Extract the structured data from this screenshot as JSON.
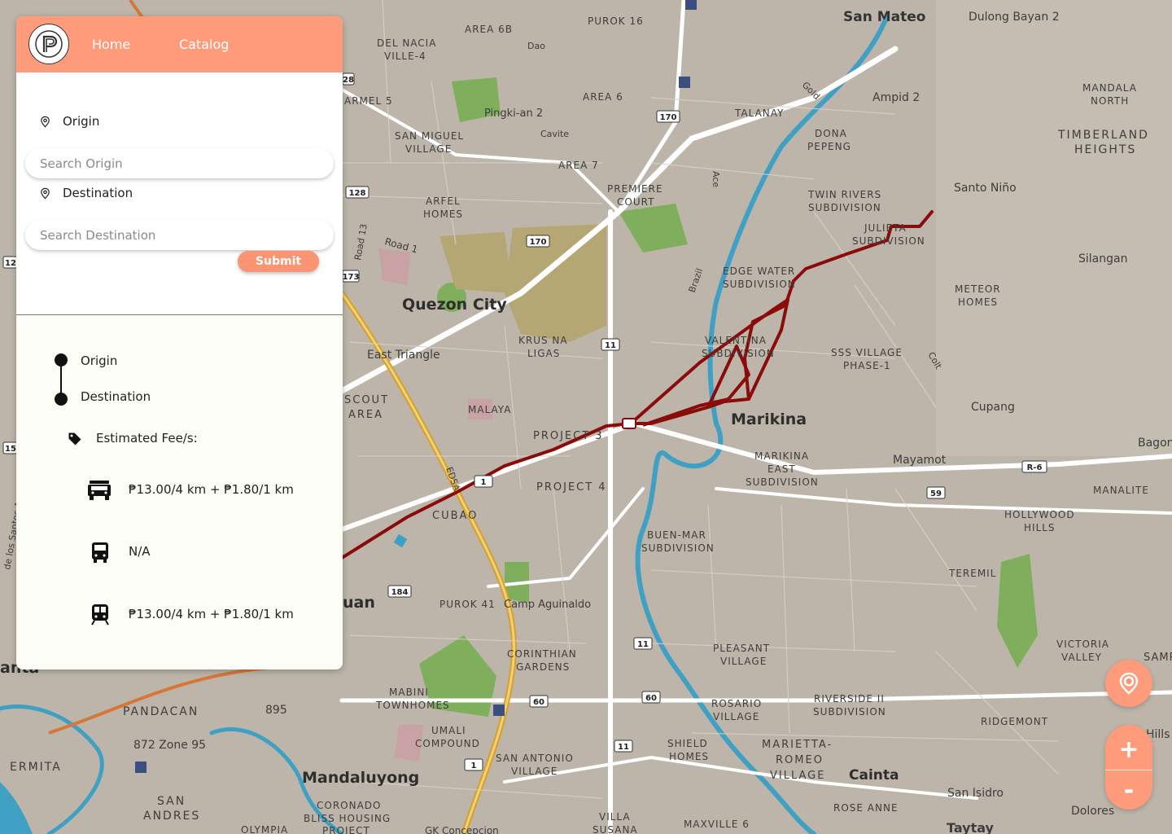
{
  "header": {
    "nav_home": "Home",
    "nav_catalog": "Catalog",
    "logo_icon": "p-logo-icon"
  },
  "search": {
    "origin_label": "Origin",
    "origin_placeholder": "Search Origin",
    "origin_value": "",
    "destination_label": "Destination",
    "destination_placeholder": "Search Destination",
    "destination_value": "",
    "submit_label": "Submit"
  },
  "route": {
    "origin_label": "Origin",
    "destination_label": "Destination",
    "fee_heading": "Estimated Fee/s:",
    "fares": [
      {
        "icon": "jeepney-icon",
        "value": "₱13.00/4 km + ₱1.80/1 km"
      },
      {
        "icon": "bus-icon",
        "value": "N/A"
      },
      {
        "icon": "train-icon",
        "value": "₱13.00/4 km + ₱1.80/1 km"
      }
    ]
  },
  "map_controls": {
    "locate_icon": "location-pin-icon",
    "zoom_in": "+",
    "zoom_out": "-"
  },
  "map": {
    "route_color": "#8b0a0a",
    "labels": [
      "San Mateo",
      "Dulong Bayan 2",
      "PUROK 16",
      "AREA 6B",
      "Dao",
      "DEL NACIA VILLE-4",
      "ARMEL 5",
      "Pingki-an 2",
      "AREA 6",
      "TALANAY",
      "Ampid 2",
      "MANDALA NORTH",
      "SAN MIGUEL VILLAGE",
      "Cavite",
      "DONA PEPENG",
      "TIMBERLAND HEIGHTS",
      "AREA 7",
      "PREMIERE COURT",
      "TWIN RIVERS SUBDIVISION",
      "Santo Niño",
      "ARFEL HOMES",
      "JULIETA SUBDIVISION",
      "Road 1",
      "Silangan",
      "EDGE WATER SUBDIVISION",
      "METEOR HOMES",
      "Quezon City",
      "KRUS NA LIGAS",
      "VALENTINA SUBDIVISION",
      "SSS VILLAGE PHASE-1",
      "East Triangle",
      "SCOUT AREA",
      "MALAYA",
      "Cupang",
      "Marikina",
      "PROJECT 3",
      "Bagon",
      "MARIKINA EAST SUBDIVISION",
      "Mayamot",
      "PROJECT 4",
      "CUBAO",
      "MANALITE",
      "HOLLYWOOD HILLS",
      "BUEN-MAR SUBDIVISION",
      "TEREMIL",
      "uan",
      "PUROK 41",
      "Camp Aguinaldo",
      "PLEASANT VILLAGE",
      "VICTORIA VALLEY",
      "CORINTHIAN GARDENS",
      "SAMP",
      "MABINI TOWNHOMES",
      "ROSARIO VILLAGE",
      "RIVERSIDE II SUBDIVISION",
      "PANDACAN",
      "895",
      "RIDGEMONT",
      "872 Zone 95",
      "UMALI COMPOUND",
      "SHIELD HOMES",
      "MARIETTA-ROMEO VILLAGE",
      "Hills",
      "ERMITA",
      "SAN ANTONIO VILLAGE",
      "Cainta",
      "Mandaluyong",
      "SAN ANDRES",
      "CORONADO BLISS HOUSING PROJECT",
      "VILLA SUSANA",
      "San Isidro",
      "ROSE ANNE",
      "Dolores",
      "Taytay",
      "OLYMPIA",
      "GK Concepcion",
      "MAXVILLE 6",
      "anta",
      "EDSA",
      "Gold",
      "Ace",
      "Brazil",
      "Colt",
      "Road 13",
      "de los Santos Avenue"
    ],
    "route_shields": [
      "170",
      "170",
      "170",
      "128",
      "11",
      "11",
      "11",
      "11",
      "R-6",
      "59",
      "60",
      "60",
      "184",
      "1",
      "173",
      "12",
      "15"
    ]
  }
}
